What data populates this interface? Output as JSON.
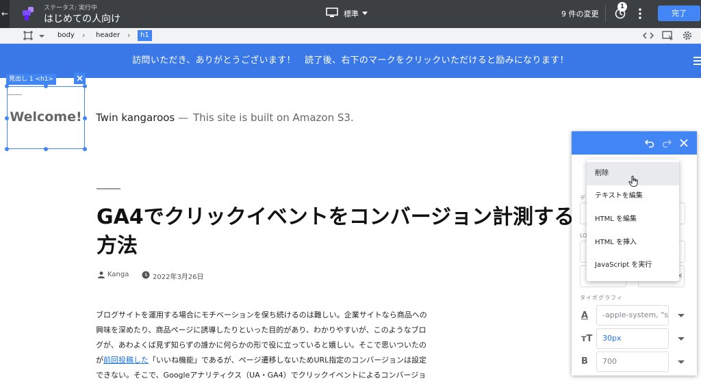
{
  "topbar": {
    "status": "ステータス: 実行中",
    "container_name": "はじめての人向け",
    "device_label": "標準",
    "changes_label": "9 件の変更",
    "history_badge": "1",
    "done_label": "完了"
  },
  "breadcrumb": {
    "items": [
      "body",
      "header",
      "h1"
    ]
  },
  "banner": {
    "text": "訪問いただき、ありがとうございます！　読了後、右下のマークをクリックいただけると励みになります！"
  },
  "selection": {
    "tag": "見出し 1 <h1>",
    "welcome": "Welcome!"
  },
  "site": {
    "name": "Twin kangaroos",
    "separator": "—",
    "description": "This site is built on Amazon S3."
  },
  "article": {
    "title": "GA4でクリックイベントをコンバージョン計測する方法",
    "author": "Kanga",
    "date": "2022年3月26日",
    "body_line1": "ブログサイトを運用する場合にモチベーションを保ち続けるのは難しい。企業サイトなら商品への",
    "body_line2": "興味を深めたり、商品ページに誘導したりといった目的があり、わかりやすいが、このようなブロ",
    "body_line3": "グが、あわよくば見ず知らずの誰かに何らかの形で役に立っていると嬉しい。そこで思いついたの",
    "body_line4_prefix": "が",
    "body_line4_link": "前回投稿した",
    "body_line4_suffix": "「いいね機能」であるが、ページ遷移しないためURL指定のコンバージョンは設定",
    "body_line5": "できない。そこで、Googleアナリティクス（UA・GA4）でクリックイベントによるコンバージョ"
  },
  "panel": {
    "label_d": "デ",
    "label_lo": "LO",
    "typography_label": "タイポグラフィ",
    "font_family": "-apple-system, \"sys",
    "font_size": "30px",
    "font_weight": "700",
    "font_icon": "A",
    "size_icon": "тT",
    "weight_icon": "B"
  },
  "context_menu": {
    "items": [
      "削除",
      "テキストを編集",
      "HTML を編集",
      "HTML を挿入",
      "JavaScript を実行"
    ]
  },
  "colors": {
    "accent": "#4285f4",
    "banner": "#3b78e7",
    "topbar": "#3c4043"
  }
}
